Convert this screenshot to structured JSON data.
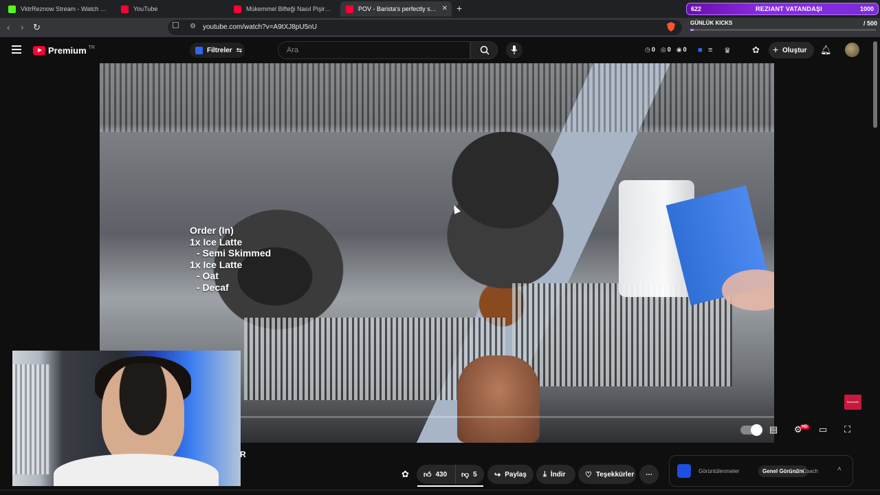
{
  "browser": {
    "tabs": [
      {
        "title": "VktrReznow Stream - Watch Live",
        "favicon": "kick-icon",
        "active": false
      },
      {
        "title": "YouTube",
        "favicon": "youtube-icon",
        "active": false
      },
      {
        "title": "Mükemmel Bifteği Nasıl Pişiririz - YouTube",
        "favicon": "youtube-icon",
        "active": false
      },
      {
        "title": "POV - Barista's perfectly synchronized workflow",
        "favicon": "youtube-icon",
        "active": true
      }
    ],
    "new_tab_label": "+",
    "url": "youtube.com/watch?v=A9tXJ8pU5nU",
    "twitch_bar": {
      "left": "622",
      "middle": "REZIANT VATANDAŞI",
      "right": "1000"
    },
    "kicks": {
      "label": "GÜNLÜK KICKS",
      "count": "/ 500",
      "progress": 0.02
    }
  },
  "youtube": {
    "logo_text": "Premium",
    "country_code": "TR",
    "filter_label": "Filtreler",
    "search_placeholder": "Ara",
    "stats": [
      {
        "icon": "clock-icon",
        "value": "0"
      },
      {
        "icon": "target-icon",
        "value": "0"
      },
      {
        "icon": "eye-icon",
        "value": "0"
      }
    ],
    "create_label": "Oluştur"
  },
  "video": {
    "overlay_lines": [
      "Order (In)",
      "1x Ice Latte",
      "- Semi Skimmed",
      "1x Ice Latte",
      "- Oat",
      "- Decaf"
    ],
    "progress": 0.0,
    "hd_badge": "HD",
    "subscribe_watermark": "Subscribe"
  },
  "webcam": {
    "partial_text": "R"
  },
  "actions": {
    "likes": "430",
    "dislikes": "5",
    "share": "Paylaş",
    "download": "İndir",
    "thanks": "Teşekkürler",
    "more": "⋯"
  },
  "side_panel": {
    "tabs": [
      "Görüntülenmeler",
      "Genel Görünüm",
      "AI Coach"
    ],
    "active_tab": "Genel Görünüm"
  },
  "colors": {
    "brand": "#ff0033",
    "background": "#0f0f0f",
    "accent": "#8a2be2"
  }
}
